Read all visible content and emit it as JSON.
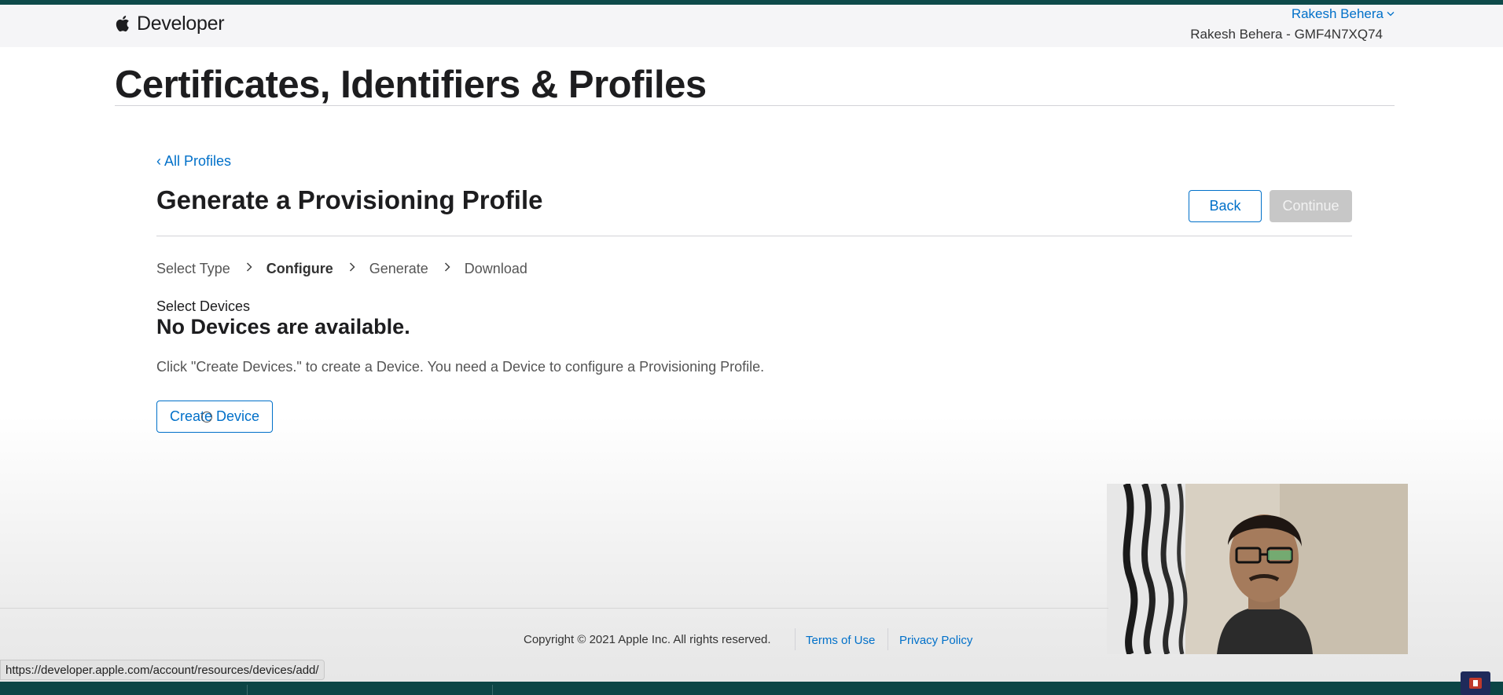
{
  "header": {
    "brand": "Developer",
    "account_name": "Rakesh Behera",
    "team_line": "Rakesh Behera - GMF4N7XQ74"
  },
  "page": {
    "title": "Certificates, Identifiers & Profiles"
  },
  "section": {
    "back_link": "‹ All Profiles",
    "title": "Generate a Provisioning Profile",
    "back_button": "Back",
    "continue_button": "Continue"
  },
  "steps": [
    {
      "label": "Select Type",
      "active": false
    },
    {
      "label": "Configure",
      "active": true
    },
    {
      "label": "Generate",
      "active": false
    },
    {
      "label": "Download",
      "active": false
    }
  ],
  "devices": {
    "label": "Select Devices",
    "heading": "No Devices are available.",
    "description": "Click \"Create Devices.\" to create a Device. You need a Device to configure a Provisioning Profile.",
    "create_button": "Create Device"
  },
  "footer": {
    "copyright": "Copyright © 2021 Apple Inc. All rights reserved.",
    "terms": "Terms of Use",
    "privacy": "Privacy Policy"
  },
  "status_bar": {
    "url": "https://developer.apple.com/account/resources/devices/add/"
  },
  "colors": {
    "link_blue": "#0070c9",
    "disabled_button": "#c7c7c7",
    "title_text": "#1d1d1f"
  },
  "icons": [
    "apple-logo-icon",
    "chevron-down-icon",
    "chevron-left-icon",
    "chevron-right-icon",
    "cursor-icon"
  ]
}
